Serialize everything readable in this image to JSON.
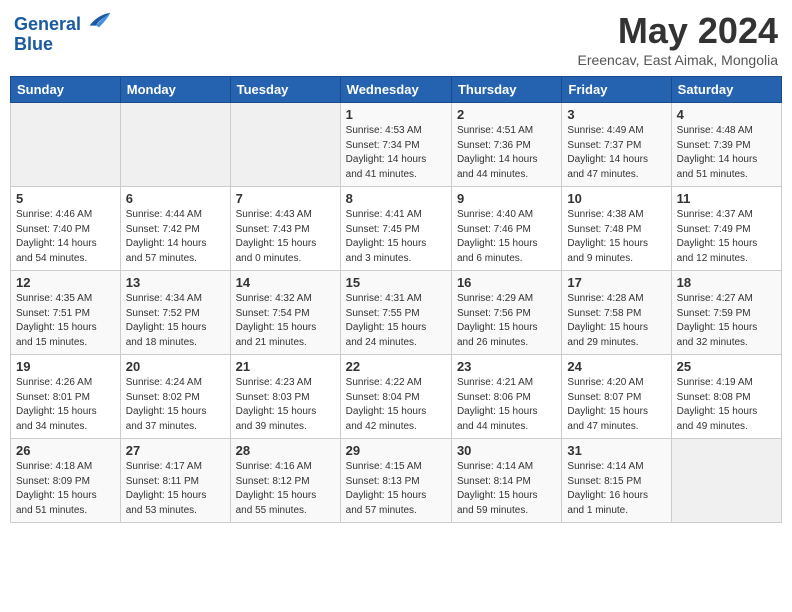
{
  "header": {
    "logo_line1": "General",
    "logo_line2": "Blue",
    "month_title": "May 2024",
    "subtitle": "Ereencav, East Aimak, Mongolia"
  },
  "days_of_week": [
    "Sunday",
    "Monday",
    "Tuesday",
    "Wednesday",
    "Thursday",
    "Friday",
    "Saturday"
  ],
  "weeks": [
    [
      {
        "day": "",
        "info": ""
      },
      {
        "day": "",
        "info": ""
      },
      {
        "day": "",
        "info": ""
      },
      {
        "day": "1",
        "info": "Sunrise: 4:53 AM\nSunset: 7:34 PM\nDaylight: 14 hours\nand 41 minutes."
      },
      {
        "day": "2",
        "info": "Sunrise: 4:51 AM\nSunset: 7:36 PM\nDaylight: 14 hours\nand 44 minutes."
      },
      {
        "day": "3",
        "info": "Sunrise: 4:49 AM\nSunset: 7:37 PM\nDaylight: 14 hours\nand 47 minutes."
      },
      {
        "day": "4",
        "info": "Sunrise: 4:48 AM\nSunset: 7:39 PM\nDaylight: 14 hours\nand 51 minutes."
      }
    ],
    [
      {
        "day": "5",
        "info": "Sunrise: 4:46 AM\nSunset: 7:40 PM\nDaylight: 14 hours\nand 54 minutes."
      },
      {
        "day": "6",
        "info": "Sunrise: 4:44 AM\nSunset: 7:42 PM\nDaylight: 14 hours\nand 57 minutes."
      },
      {
        "day": "7",
        "info": "Sunrise: 4:43 AM\nSunset: 7:43 PM\nDaylight: 15 hours\nand 0 minutes."
      },
      {
        "day": "8",
        "info": "Sunrise: 4:41 AM\nSunset: 7:45 PM\nDaylight: 15 hours\nand 3 minutes."
      },
      {
        "day": "9",
        "info": "Sunrise: 4:40 AM\nSunset: 7:46 PM\nDaylight: 15 hours\nand 6 minutes."
      },
      {
        "day": "10",
        "info": "Sunrise: 4:38 AM\nSunset: 7:48 PM\nDaylight: 15 hours\nand 9 minutes."
      },
      {
        "day": "11",
        "info": "Sunrise: 4:37 AM\nSunset: 7:49 PM\nDaylight: 15 hours\nand 12 minutes."
      }
    ],
    [
      {
        "day": "12",
        "info": "Sunrise: 4:35 AM\nSunset: 7:51 PM\nDaylight: 15 hours\nand 15 minutes."
      },
      {
        "day": "13",
        "info": "Sunrise: 4:34 AM\nSunset: 7:52 PM\nDaylight: 15 hours\nand 18 minutes."
      },
      {
        "day": "14",
        "info": "Sunrise: 4:32 AM\nSunset: 7:54 PM\nDaylight: 15 hours\nand 21 minutes."
      },
      {
        "day": "15",
        "info": "Sunrise: 4:31 AM\nSunset: 7:55 PM\nDaylight: 15 hours\nand 24 minutes."
      },
      {
        "day": "16",
        "info": "Sunrise: 4:29 AM\nSunset: 7:56 PM\nDaylight: 15 hours\nand 26 minutes."
      },
      {
        "day": "17",
        "info": "Sunrise: 4:28 AM\nSunset: 7:58 PM\nDaylight: 15 hours\nand 29 minutes."
      },
      {
        "day": "18",
        "info": "Sunrise: 4:27 AM\nSunset: 7:59 PM\nDaylight: 15 hours\nand 32 minutes."
      }
    ],
    [
      {
        "day": "19",
        "info": "Sunrise: 4:26 AM\nSunset: 8:01 PM\nDaylight: 15 hours\nand 34 minutes."
      },
      {
        "day": "20",
        "info": "Sunrise: 4:24 AM\nSunset: 8:02 PM\nDaylight: 15 hours\nand 37 minutes."
      },
      {
        "day": "21",
        "info": "Sunrise: 4:23 AM\nSunset: 8:03 PM\nDaylight: 15 hours\nand 39 minutes."
      },
      {
        "day": "22",
        "info": "Sunrise: 4:22 AM\nSunset: 8:04 PM\nDaylight: 15 hours\nand 42 minutes."
      },
      {
        "day": "23",
        "info": "Sunrise: 4:21 AM\nSunset: 8:06 PM\nDaylight: 15 hours\nand 44 minutes."
      },
      {
        "day": "24",
        "info": "Sunrise: 4:20 AM\nSunset: 8:07 PM\nDaylight: 15 hours\nand 47 minutes."
      },
      {
        "day": "25",
        "info": "Sunrise: 4:19 AM\nSunset: 8:08 PM\nDaylight: 15 hours\nand 49 minutes."
      }
    ],
    [
      {
        "day": "26",
        "info": "Sunrise: 4:18 AM\nSunset: 8:09 PM\nDaylight: 15 hours\nand 51 minutes."
      },
      {
        "day": "27",
        "info": "Sunrise: 4:17 AM\nSunset: 8:11 PM\nDaylight: 15 hours\nand 53 minutes."
      },
      {
        "day": "28",
        "info": "Sunrise: 4:16 AM\nSunset: 8:12 PM\nDaylight: 15 hours\nand 55 minutes."
      },
      {
        "day": "29",
        "info": "Sunrise: 4:15 AM\nSunset: 8:13 PM\nDaylight: 15 hours\nand 57 minutes."
      },
      {
        "day": "30",
        "info": "Sunrise: 4:14 AM\nSunset: 8:14 PM\nDaylight: 15 hours\nand 59 minutes."
      },
      {
        "day": "31",
        "info": "Sunrise: 4:14 AM\nSunset: 8:15 PM\nDaylight: 16 hours\nand 1 minute."
      },
      {
        "day": "",
        "info": ""
      }
    ]
  ]
}
